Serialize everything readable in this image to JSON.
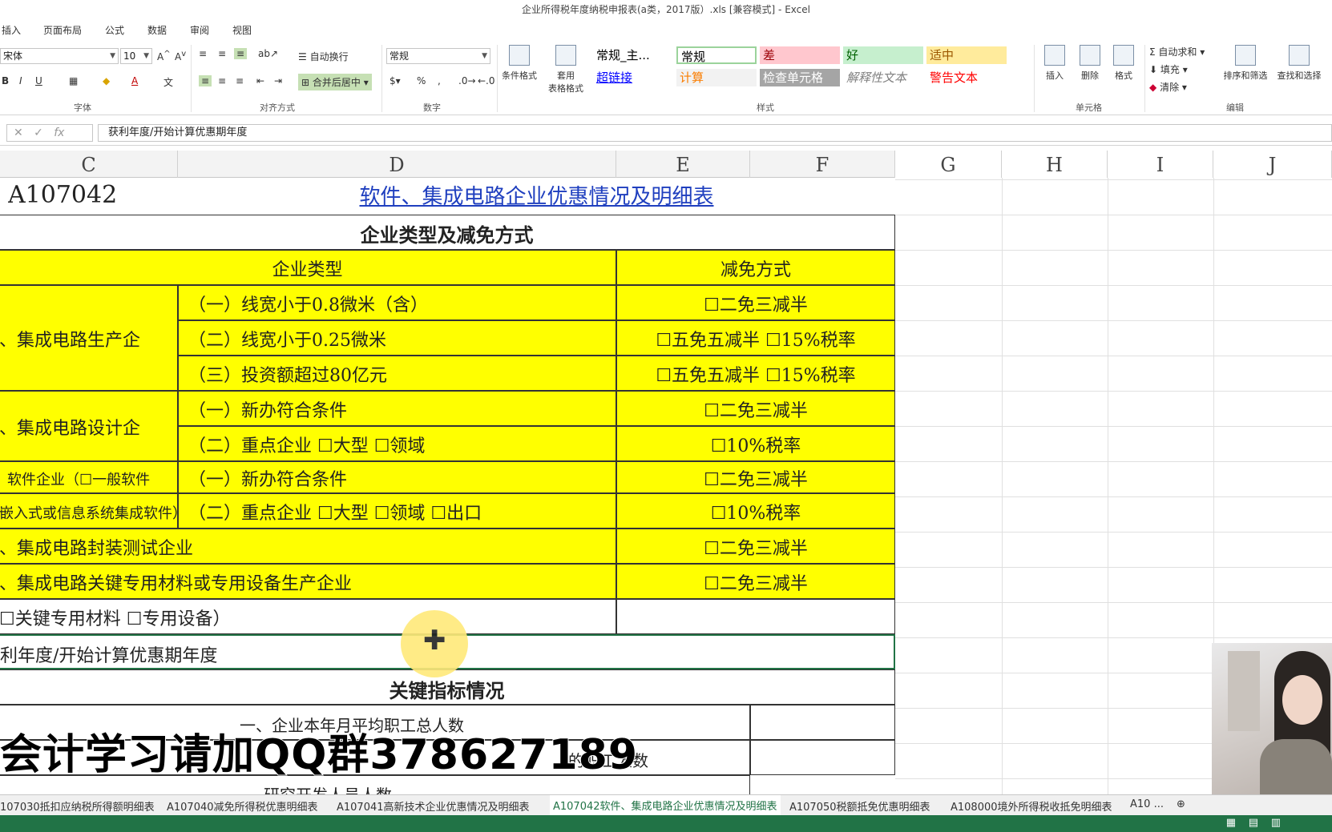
{
  "window": {
    "title": "企业所得税年度纳税申报表(a类，2017版）.xls  [兼容模式] - Excel"
  },
  "ribbon_tabs": [
    "插入",
    "页面布局",
    "公式",
    "数据",
    "审阅",
    "视图"
  ],
  "ribbon": {
    "font": {
      "name": "宋体",
      "size": "10",
      "group_label": "字体"
    },
    "alignment": {
      "wrap_text": "自动换行",
      "merge_center": "合并后居中",
      "group_label": "对齐方式"
    },
    "number": {
      "format": "常规",
      "percent": "%",
      "comma": ",",
      "group_label": "数字"
    },
    "styles": {
      "conditional": "条件格式",
      "table_format_1": "套用",
      "table_format_2": "表格格式",
      "group_label": "样式",
      "cells": [
        {
          "label": "常规_主...",
          "bg": "#ffffff",
          "fg": "#000000"
        },
        {
          "label": "常规",
          "bg": "#ffffff",
          "fg": "#000000"
        },
        {
          "label": "差",
          "bg": "#ffc7ce",
          "fg": "#9c0006"
        },
        {
          "label": "好",
          "bg": "#c6efce",
          "fg": "#006100"
        },
        {
          "label": "适中",
          "bg": "#ffeb9c",
          "fg": "#9c5700"
        },
        {
          "label": "超链接",
          "bg": "#ffffff",
          "fg": "#0000ff"
        },
        {
          "label": "计算",
          "bg": "#f2f2f2",
          "fg": "#fa7d00"
        },
        {
          "label": "检查单元格",
          "bg": "#a5a5a5",
          "fg": "#ffffff"
        },
        {
          "label": "解释性文本",
          "bg": "#ffffff",
          "fg": "#7f7f7f"
        },
        {
          "label": "警告文本",
          "bg": "#ffffff",
          "fg": "#ff0000"
        }
      ]
    },
    "cells_group": {
      "insert": "插入",
      "delete": "删除",
      "format": "格式",
      "group_label": "单元格"
    },
    "editing": {
      "autosum": "自动求和",
      "fill": "填充",
      "clear": "清除",
      "sort": "排序和筛选",
      "find": "查找和选择",
      "group_label": "编辑"
    }
  },
  "formula_bar": {
    "fx": "fx",
    "content": "获利年度/开始计算优惠期年度"
  },
  "columns": [
    "C",
    "D",
    "E",
    "F",
    "G",
    "H",
    "I",
    "J"
  ],
  "sheet": {
    "code": "A107042",
    "title": "软件、集成电路企业优惠情况及明细表",
    "section1": "企业类型及减免方式",
    "hdr_type": "企业类型",
    "hdr_method": "减免方式",
    "rows": [
      {
        "c": "、集成电路生产企",
        "d": "（一）线宽小于0.8微米（含）",
        "ef": "☐二免三减半"
      },
      {
        "c": "",
        "d": "（二）线宽小于0.25微米",
        "ef": "☐五免五减半   ☐15%税率"
      },
      {
        "c": "",
        "d": "（三）投资额超过80亿元",
        "ef": "☐五免五减半   ☐15%税率"
      },
      {
        "c": "、集成电路设计企",
        "d": "（一）新办符合条件",
        "ef": "☐二免三减半"
      },
      {
        "c": "",
        "d": "（二）重点企业 ☐大型 ☐领域",
        "ef": "☐10%税率"
      },
      {
        "c": "软件企业（☐一般软件",
        "d": "（一）新办符合条件",
        "ef": "☐二免三减半"
      },
      {
        "c": "嵌入式或信息系统集成软件）",
        "d": "（二）重点企业 ☐大型 ☐领域 ☐出口",
        "ef": "☐10%税率"
      },
      {
        "c": "、集成电路封装测试企业",
        "d": "",
        "ef": "☐二免三减半"
      },
      {
        "c": "、集成电路关键专用材料或专用设备生产企业",
        "d": "",
        "ef": "☐二免三减半"
      }
    ],
    "materials": "☐关键专用材料    ☐专用设备）",
    "profit_year": "利年度/开始计算优惠期年度",
    "section2": "关键指标情况",
    "row_staff": "一、企业本年月平均职工总人数",
    "row_staff2": "的职工人数",
    "row_rd": "研究开发人员人数"
  },
  "watermark": "会计学习请加QQ群378627189",
  "sheet_tabs": [
    "107030抵扣应纳税所得额明细表",
    "A107040减免所得税优惠明细表",
    "A107041高新技术企业优惠情况及明细表",
    "A107042软件、集成电路企业优惠情况及明细表",
    "A107050税额抵免优惠明细表",
    "A108000境外所得税收抵免明细表",
    "A10 ..."
  ],
  "colors": {
    "accent": "#217346",
    "highlight": "#ffff00",
    "link": "#1f3fbf"
  }
}
